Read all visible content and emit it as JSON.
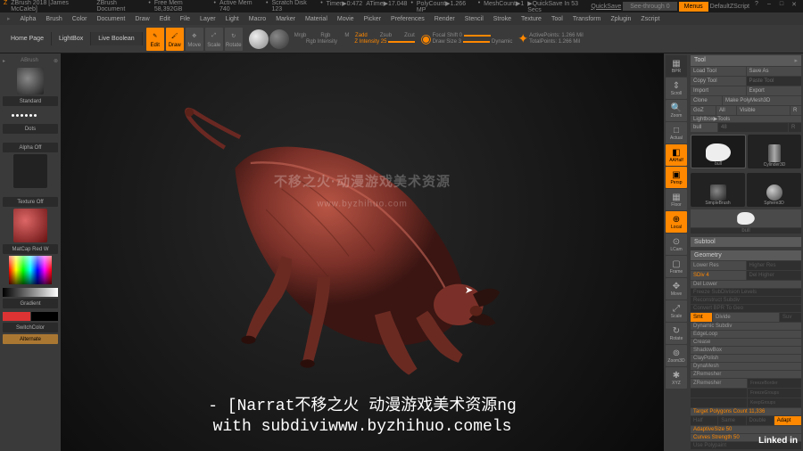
{
  "titlebar": {
    "app": "ZBrush 2018 [James McCaleb]",
    "doc": "ZBrush Document",
    "mem": "Free Mem 58,392GB",
    "active_mem": "Active Mem 740",
    "scratch": "Scratch Disk 123",
    "timer": "Timer▶0:472",
    "atime": "ATime▶17.048",
    "poly": "PolyCount▶1.266 MP",
    "mesh": "MeshCount▶1",
    "quicksave": "▶QuickSave In 53 Secs",
    "quicksave_btn": "QuickSave",
    "see_through": "See-through  0",
    "menus": "Menus",
    "config": "DefaultZScript"
  },
  "menubar": {
    "items": [
      "Alpha",
      "Brush",
      "Color",
      "Document",
      "Draw",
      "Edit",
      "File",
      "Layer",
      "Light",
      "Macro",
      "Marker",
      "Material",
      "Movie",
      "Picker",
      "Preferences",
      "Render",
      "Stencil",
      "Stroke",
      "Texture",
      "Tool",
      "Transform",
      "Zplugin",
      "Zscript"
    ]
  },
  "tabs": {
    "home": "Home Page",
    "lightbox": "LightBox",
    "live": "Live Boolean"
  },
  "toolbar": {
    "edit": "Edit",
    "draw": "Draw",
    "move": "Move",
    "scale": "Scale",
    "rotate": "Rotate",
    "mrgb": "Mrgb",
    "rgb": "Rgb",
    "m": "M",
    "zadd": "Zadd",
    "zsub": "Zsub",
    "zcut": "Zcut",
    "rgb_intensity": "Rgb Intensity",
    "z_intensity": "Z Intensity  25",
    "focal_shift": "Focal Shift  0",
    "draw_size": "Draw Size  3",
    "dynamic": "Dynamic",
    "active_points": "ActivePoints: 1.266 Mil",
    "total_points": "TotalPoints: 1.266 Mil"
  },
  "left": {
    "abrush": "ABrush",
    "standard": "Standard",
    "dots": "Dots",
    "alpha_off": "Alpha Off",
    "texture_off": "Texture Off",
    "matcap": "MatCap Red W",
    "gradient": "Gradient",
    "switch_color": "SwitchColor",
    "alternate": "Alternate"
  },
  "right_toolbar": {
    "items": [
      "BPR",
      "Scroll",
      "Zoom",
      "Actual",
      "AAHalf",
      "Persp",
      "Floor",
      "Local",
      "LCam",
      "Frame",
      "Move",
      "Scale",
      "Rotate",
      "Zoom3D",
      "XYZ"
    ]
  },
  "right_panel": {
    "tool": "Tool",
    "load_tool": "Load Tool",
    "save_as": "Save As",
    "copy_tool": "Copy Tool",
    "paste_tool": "Paste Tool",
    "import": "Import",
    "export": "Export",
    "clone": "Clone",
    "make_polymesh": "Make PolyMesh3D",
    "goz": "GoZ",
    "all": "All",
    "visible": "Visible",
    "r": "R",
    "lightbox_tools": "Lightbox▶Tools",
    "bull": "bull",
    "bull_label": "bull",
    "cylinder": "Cylinder3D",
    "simplebrush": "SimpleBrush",
    "sphere": "Sphere3D",
    "subtool": "Subtool",
    "geometry": "Geometry",
    "lower_res": "Lower Res",
    "higher_res": "Higher Res",
    "sdiv": "SDiv  4",
    "del_higher": "Del Higher",
    "del_lower": "Del Lower",
    "freeze_sub": "Freeze SubDivision Levels",
    "reconstruct": "Reconstruct Subdiv",
    "convert_bpr": "Convert BPR To Geo",
    "smt": "Smt",
    "divide": "Divide",
    "suv": "Suv",
    "dynamic_subdiv": "Dynamic Subdiv",
    "edgeloop": "EdgeLoop",
    "crease": "Crease",
    "shadowbox": "ShadowBox",
    "claypolish": "ClayPolish",
    "dynamesh": "DynaMesh",
    "zremesher": "ZRemesher",
    "zremesher2": "ZRemesher",
    "freezeborder": "FreezeBorder",
    "freezegroups": "FreezeGroups",
    "keepgroups": "KeepGroups",
    "target_poly": "Target Polygons Count 11,336",
    "half": "Half",
    "same": "Same",
    "double": "Double",
    "adapt": "Adapt",
    "adaptive": "AdaptiveSize 50",
    "curves": "Curves Strength 50",
    "use_polypaint": "Use Polypaint"
  },
  "subtitles": {
    "line1": "- [Narrat不移之火 动漫游戏美术资源ng",
    "line2": "with subdiviwww.byzhihuo.comels"
  },
  "badge": "Linked in"
}
